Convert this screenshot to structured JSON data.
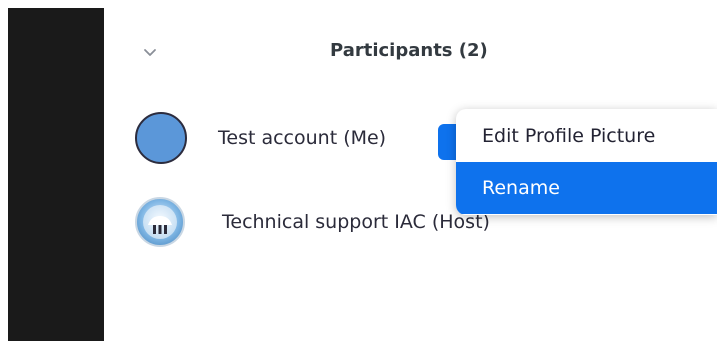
{
  "panel": {
    "title": "Participants (2)"
  },
  "participants": [
    {
      "name": "Test account (Me)",
      "avatar_icon": "avatar-placeholder-icon",
      "avatar_color": "#5b97d9"
    },
    {
      "name": "Technical support IAC (Host)",
      "avatar_icon": "host-avatar-icon"
    }
  ],
  "context_menu": {
    "items": [
      {
        "label": "Edit Profile Picture",
        "active": false
      },
      {
        "label": "Rename",
        "active": true
      }
    ]
  },
  "icons": {
    "collapse": "chevron-down-icon",
    "more": "more-button"
  },
  "colors": {
    "accent": "#0e72ed",
    "sidebar": "#1a1a1a"
  }
}
